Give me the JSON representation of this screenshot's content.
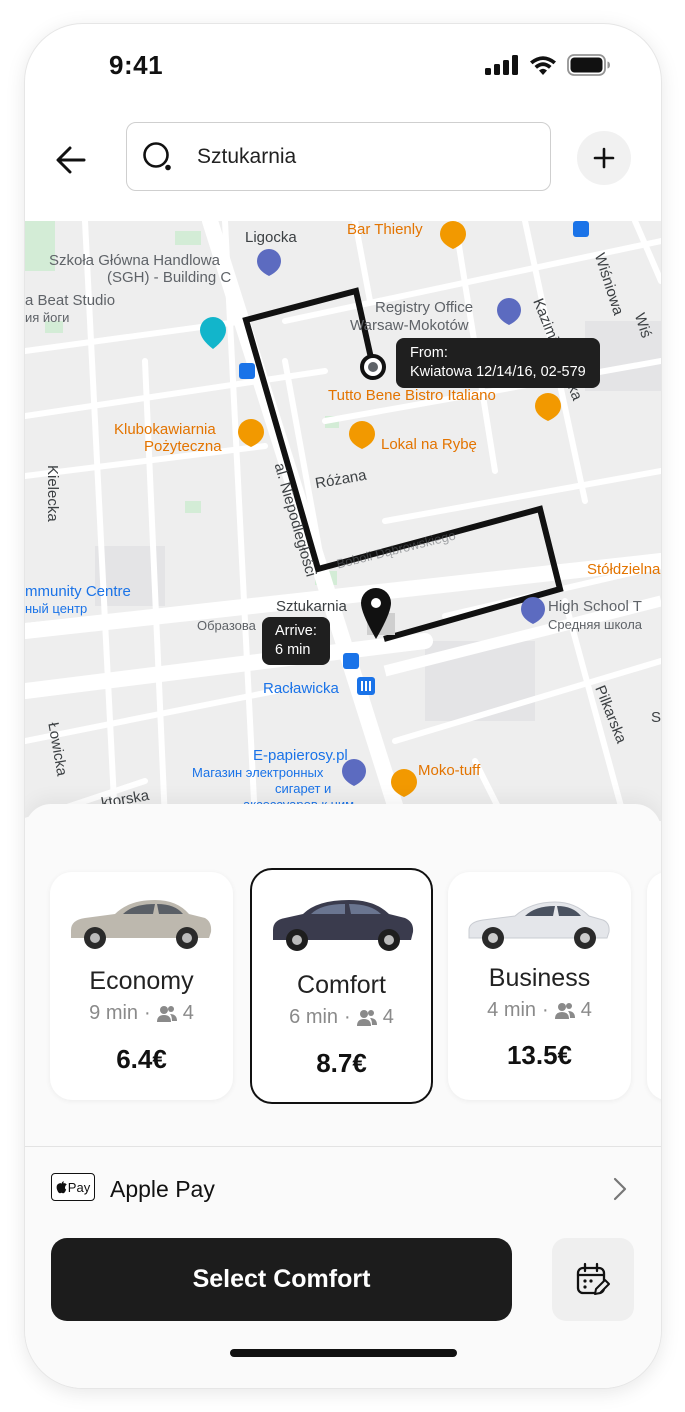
{
  "status_bar": {
    "time": "9:41"
  },
  "header": {
    "search_value": "Sztukarnia",
    "icons": {
      "back": "arrow-left-icon",
      "search": "search-icon",
      "add": "plus-icon"
    }
  },
  "map": {
    "labels": [
      "Ligocka",
      "Bar Thienly",
      "Wiśniowa",
      "Szkoła Główna Handlowa",
      "(SGH) - Building C",
      "a Beat Studio",
      "ия йоги",
      "Registry Office",
      "Warsaw-Mokotów",
      "Kazimierzowska",
      "Tutto Bene Bistro Italiano",
      "Klubokawiarnia",
      "Pożyteczna",
      "Lokal na Rybę",
      "Różana",
      "Kielecka",
      "al. Niepodległości",
      "mmunity Centre",
      "ный центр",
      "Stółdzielna",
      "Sztukarnia",
      "Образова",
      "High School T",
      "Средняя школа",
      "Racławicka",
      "Łowicka",
      "Pilkarska",
      "E-papierosy.pl",
      "Магазин электронных",
      "сигарет и",
      "аксессуаров к ним",
      "Moko-tuff",
      "ktorska",
      "Wiś",
      "S",
      "Boboli Dąbrowskiego"
    ],
    "from_tooltip": {
      "title": "From:",
      "address": "Kwiatowa 12/14/16, 02-579"
    },
    "arrive_tooltip": {
      "title": "Arrive:",
      "eta": "6 min"
    }
  },
  "options": [
    {
      "name": "Economy",
      "time": "9 min",
      "seats": "4",
      "price": "6.4€",
      "selected": false,
      "color": "#bdb8ae"
    },
    {
      "name": "Comfort",
      "time": "6 min",
      "seats": "4",
      "price": "8.7€",
      "selected": true,
      "color": "#3a3b4d"
    },
    {
      "name": "Business",
      "time": "4 min",
      "seats": "4",
      "price": "13.5€",
      "selected": false,
      "color": "#e4e6ea"
    }
  ],
  "payment": {
    "badge": "Pay",
    "label": "Apple Pay"
  },
  "cta": {
    "label": "Select Comfort"
  },
  "colors": {
    "primary_button": "#1c1c1c",
    "route": "#111111",
    "poi_orange": "#f29900",
    "transit_blue": "#1a73e8"
  }
}
